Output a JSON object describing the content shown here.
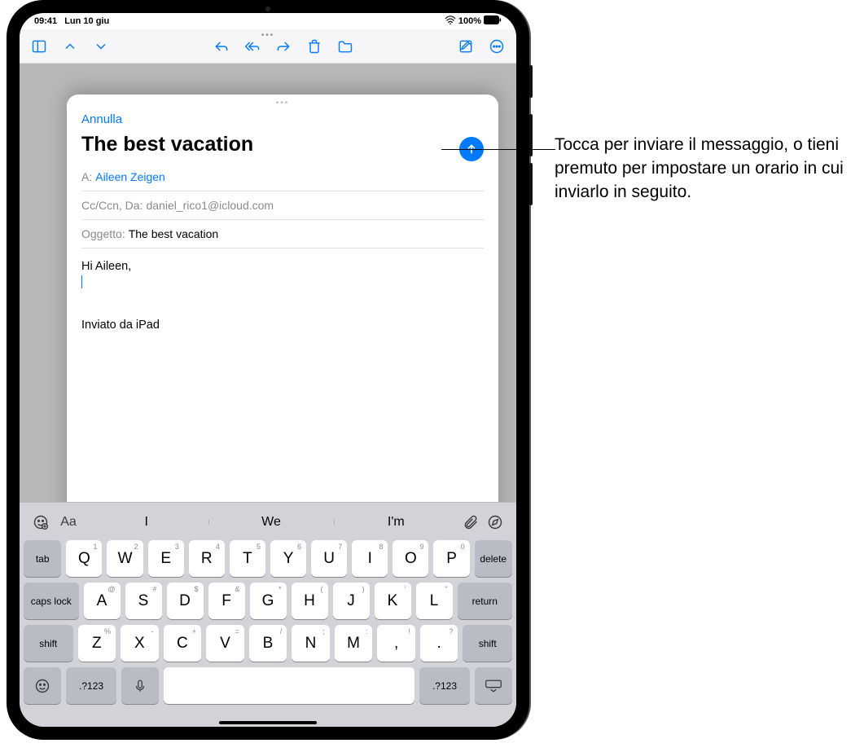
{
  "status": {
    "time": "09:41",
    "date": "Lun 10 giu",
    "battery": "100%"
  },
  "compose": {
    "cancel": "Annulla",
    "title": "The best vacation",
    "to_label": "A:",
    "to_value": "Aileen Zeigen",
    "cc_label": "Cc/Ccn, Da:",
    "cc_value": "daniel_rico1@icloud.com",
    "subject_label": "Oggetto:",
    "subject_value": "The best vacation",
    "body_line1": "Hi Aileen,",
    "signature": "Inviato da iPad"
  },
  "predictions": {
    "format": "Aa",
    "w1": "I",
    "w2": "We",
    "w3": "I'm"
  },
  "keyboard": {
    "row1": [
      {
        "k": "Q",
        "s": "1"
      },
      {
        "k": "W",
        "s": "2"
      },
      {
        "k": "E",
        "s": "3"
      },
      {
        "k": "R",
        "s": "4"
      },
      {
        "k": "T",
        "s": "5"
      },
      {
        "k": "Y",
        "s": "6"
      },
      {
        "k": "U",
        "s": "7"
      },
      {
        "k": "I",
        "s": "8"
      },
      {
        "k": "O",
        "s": "9"
      },
      {
        "k": "P",
        "s": "0"
      }
    ],
    "row2": [
      {
        "k": "A",
        "s": "@"
      },
      {
        "k": "S",
        "s": "#"
      },
      {
        "k": "D",
        "s": "$"
      },
      {
        "k": "F",
        "s": "&"
      },
      {
        "k": "G",
        "s": "*"
      },
      {
        "k": "H",
        "s": "("
      },
      {
        "k": "J",
        "s": ")"
      },
      {
        "k": "K",
        "s": "'"
      },
      {
        "k": "L",
        "s": "\""
      }
    ],
    "row3": [
      {
        "k": "Z",
        "s": "%"
      },
      {
        "k": "X",
        "s": "-"
      },
      {
        "k": "C",
        "s": "+"
      },
      {
        "k": "V",
        "s": "="
      },
      {
        "k": "B",
        "s": "/"
      },
      {
        "k": "N",
        "s": ";"
      },
      {
        "k": "M",
        "s": ":"
      },
      {
        "k": ",",
        "s": "!"
      },
      {
        "k": ".",
        "s": "?"
      }
    ],
    "tab": "tab",
    "delete": "delete",
    "caps": "caps lock",
    "return": "return",
    "shift": "shift",
    "numsym": ".?123"
  },
  "callout": "Tocca per inviare il messaggio, o tieni premuto per impostare un orario in cui inviarlo in seguito."
}
